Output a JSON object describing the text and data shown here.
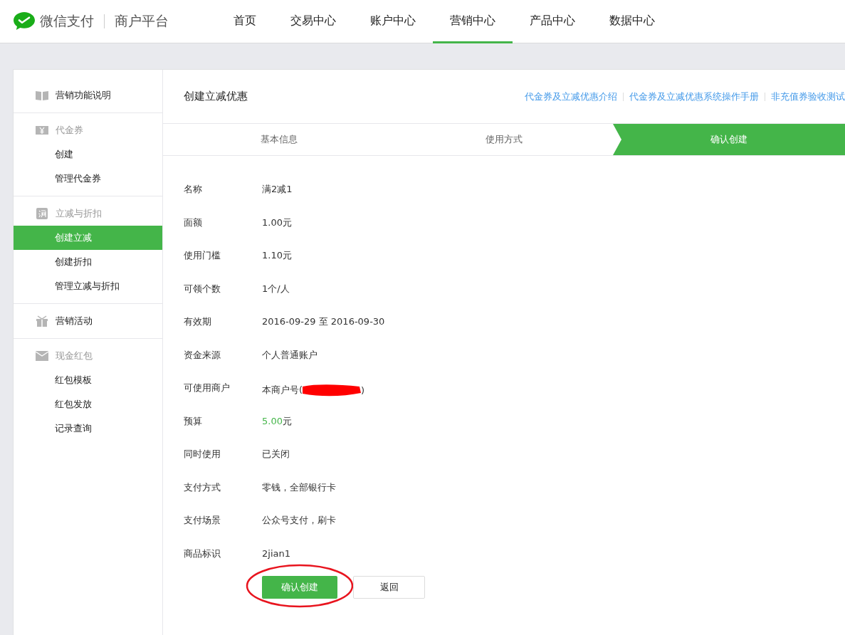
{
  "header": {
    "logo_name": "微信支付",
    "logo_subtitle": "商户平台"
  },
  "nav": [
    {
      "label": "首页",
      "selected": false
    },
    {
      "label": "交易中心",
      "selected": false
    },
    {
      "label": "账户中心",
      "selected": false
    },
    {
      "label": "营销中心",
      "selected": true
    },
    {
      "label": "产品中心",
      "selected": false
    },
    {
      "label": "数据中心",
      "selected": false
    }
  ],
  "sidebar": {
    "groups": [
      {
        "title": "营销功能说明",
        "kind": "book"
      },
      {
        "title": "代金券",
        "kind": "yen",
        "items": [
          {
            "label": "创建",
            "selected": false
          },
          {
            "label": "管理代金券",
            "selected": false
          }
        ]
      },
      {
        "title": "立减与折扣",
        "kind": "reduce",
        "items": [
          {
            "label": "创建立减",
            "selected": true
          },
          {
            "label": "创建折扣",
            "selected": false
          },
          {
            "label": "管理立减与折扣",
            "selected": false
          }
        ]
      },
      {
        "title": "营销活动",
        "kind": "gift"
      },
      {
        "title": "现金红包",
        "kind": "envelope",
        "items": [
          {
            "label": "红包模板",
            "selected": false
          },
          {
            "label": "红包发放",
            "selected": false
          },
          {
            "label": "记录查询",
            "selected": false
          }
        ]
      }
    ]
  },
  "page_title": "创建立减优惠",
  "help_links": [
    "代金券及立减优惠介绍",
    "代金券及立减优惠系统操作手册",
    "非充值券验收测试"
  ],
  "steps": [
    {
      "label": "基本信息",
      "selected": false
    },
    {
      "label": "使用方式",
      "selected": false
    },
    {
      "label": "确认创建",
      "selected": true
    }
  ],
  "details": [
    {
      "label": "名称",
      "kind": "text",
      "value": "满2减1"
    },
    {
      "label": "面额",
      "kind": "text",
      "value": "1.00元"
    },
    {
      "label": "使用门槛",
      "kind": "text",
      "value": "1.10元"
    },
    {
      "label": "可领个数",
      "kind": "text",
      "value": "1个/人"
    },
    {
      "label": "有效期",
      "kind": "text",
      "value": "2016-09-29 至 2016-09-30"
    },
    {
      "label": "资金来源",
      "kind": "text",
      "value": "个人普通账户"
    },
    {
      "label": "可使用商户",
      "kind": "redacted",
      "prefix": "本商户号(",
      "suffix": ")"
    },
    {
      "label": "预算",
      "kind": "amount",
      "amount": "5.00",
      "unit": "元"
    },
    {
      "label": "同时使用",
      "kind": "text",
      "value": "已关闭"
    },
    {
      "label": "支付方式",
      "kind": "text",
      "value": "零钱，全部银行卡"
    },
    {
      "label": "支付场景",
      "kind": "text",
      "value": "公众号支付，刷卡"
    },
    {
      "label": "商品标识",
      "kind": "text",
      "value": "2jian1"
    }
  ],
  "actions": [
    {
      "label": "确认创建",
      "kind": "primary",
      "circled": true
    },
    {
      "label": "返回",
      "kind": "secondary",
      "circled": false
    }
  ]
}
